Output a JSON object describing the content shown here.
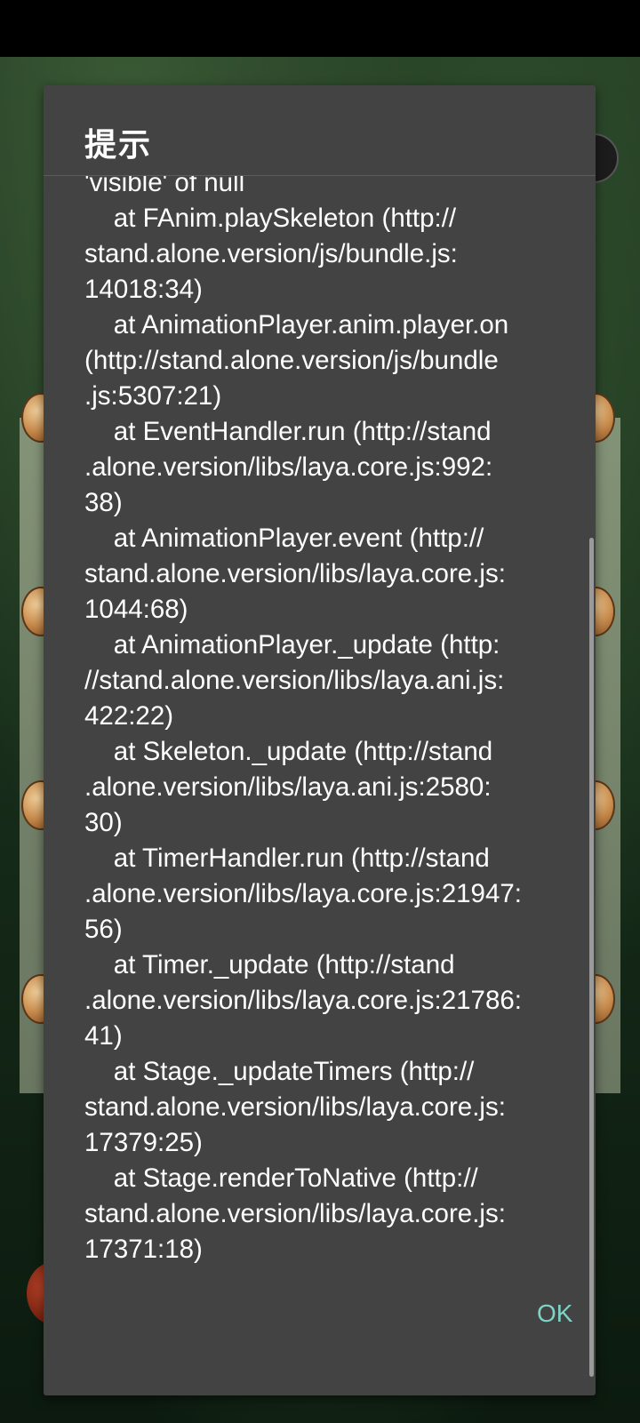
{
  "dialog": {
    "title": "提示",
    "message": "'visible' of null\n    at FAnim.playSkeleton (http://\nstand.alone.version/js/bundle.js:\n14018:34)\n    at AnimationPlayer.anim.player.on\n(http://stand.alone.version/js/bundle\n.js:5307:21)\n    at EventHandler.run (http://stand\n.alone.version/libs/laya.core.js:992:\n38)\n    at AnimationPlayer.event (http://\nstand.alone.version/libs/laya.core.js:\n1044:68)\n    at AnimationPlayer._update (http:\n//stand.alone.version/libs/laya.ani.js:\n422:22)\n    at Skeleton._update (http://stand\n.alone.version/libs/laya.ani.js:2580:\n30)\n    at TimerHandler.run (http://stand\n.alone.version/libs/laya.core.js:21947:\n56)\n    at Timer._update (http://stand\n.alone.version/libs/laya.core.js:21786:\n41)\n    at Stage._updateTimers (http://\nstand.alone.version/libs/laya.core.js:\n17379:25)\n    at Stage.renderToNative (http://\nstand.alone.version/libs/laya.core.js:\n17371:18)",
    "ok_label": "OK"
  },
  "colors": {
    "dialog_background": "#434343",
    "text": "#ffffff",
    "accent": "#7dd3c6"
  }
}
